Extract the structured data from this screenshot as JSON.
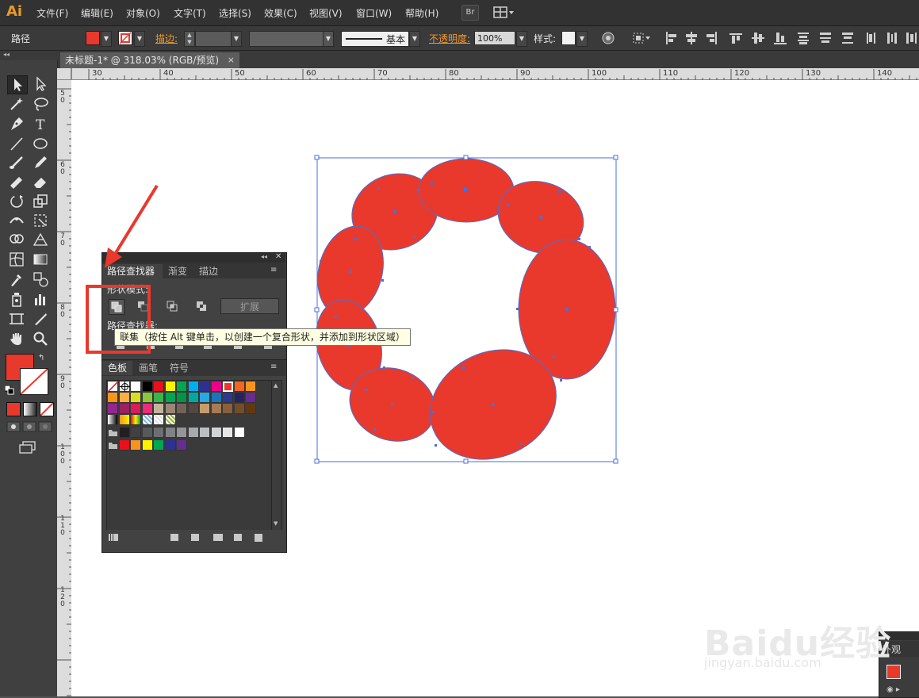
{
  "app": {
    "logo": "Ai"
  },
  "menu": {
    "items": [
      "文件(F)",
      "编辑(E)",
      "对象(O)",
      "文字(T)",
      "选择(S)",
      "效果(C)",
      "视图(V)",
      "窗口(W)",
      "帮助(H)"
    ],
    "bridge_label": "Br"
  },
  "control_bar": {
    "object_type": "路径",
    "stroke_label": "描边:",
    "stroke_style": "基本",
    "opacity_label": "不透明度:",
    "opacity_value": "100%",
    "style_label": "样式:",
    "fill_color": "#e8392c"
  },
  "document": {
    "tab_title": "未标题-1* @ 318.03% (RGB/预览)",
    "close": "×"
  },
  "rulers": {
    "horizontal": [
      "30",
      "40",
      "50",
      "60",
      "70",
      "80",
      "90",
      "100",
      "110",
      "120",
      "130",
      "140"
    ],
    "vertical": [
      "50",
      "60",
      "70",
      "80",
      "90",
      "100",
      "110",
      "120"
    ]
  },
  "pathfinder_panel": {
    "tabs": [
      "路径查找器",
      "渐变",
      "描边"
    ],
    "shape_modes_label": "形状模式:",
    "pathfinders_label": "路径查找器:",
    "expand_button": "扩展",
    "tooltip": "联集（按住 Alt 键单击，以创建一个复合形状，并添加到形状区域）"
  },
  "swatches_panel": {
    "tabs": [
      "色板",
      "画笔",
      "符号"
    ]
  },
  "appearance_panel": {
    "tab": "外观"
  },
  "colors": {
    "accent_red": "#e8392c",
    "selection_blue": "#4a6fd8",
    "highlight_red": "#e8392c"
  },
  "watermark": {
    "brand": "Baidu经验",
    "url": "jingyan.baidu.com"
  }
}
